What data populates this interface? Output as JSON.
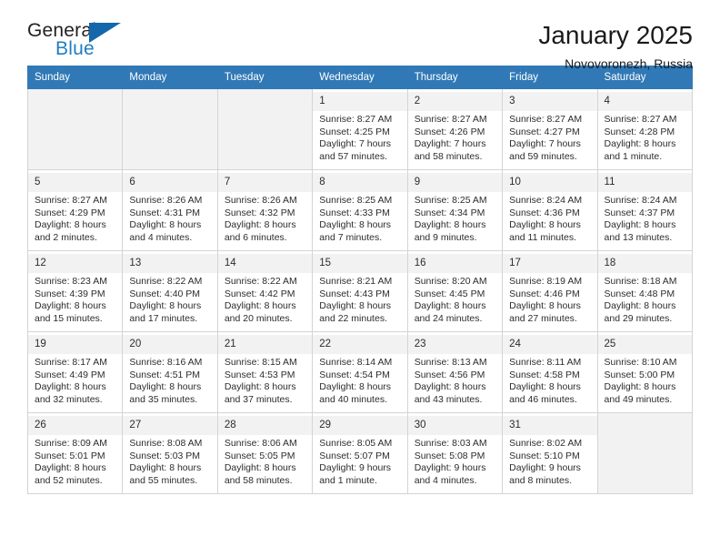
{
  "brand": {
    "name_line1": "General",
    "name_line2": "Blue",
    "triangle_color": "#1567ab",
    "blue_color": "#1f7ec2"
  },
  "header": {
    "title": "January 2025",
    "subtitle": "Novovoronezh, Russia"
  },
  "theme": {
    "header_bg": "#3179b6",
    "header_text": "#ffffff",
    "daynum_band": "#f2f2f2",
    "grid_border": "#d4d4d4"
  },
  "weekday_headers": [
    "Sunday",
    "Monday",
    "Tuesday",
    "Wednesday",
    "Thursday",
    "Friday",
    "Saturday"
  ],
  "labels": {
    "sunrise_prefix": "Sunrise: ",
    "sunset_prefix": "Sunset: ",
    "daylight_prefix": "Daylight: "
  },
  "weeks": [
    [
      {
        "empty": true
      },
      {
        "empty": true
      },
      {
        "empty": true
      },
      {
        "day": "1",
        "sunrise": "Sunrise: 8:27 AM",
        "sunset": "Sunset: 4:25 PM",
        "daylight1": "Daylight: 7 hours",
        "daylight2": "and 57 minutes."
      },
      {
        "day": "2",
        "sunrise": "Sunrise: 8:27 AM",
        "sunset": "Sunset: 4:26 PM",
        "daylight1": "Daylight: 7 hours",
        "daylight2": "and 58 minutes."
      },
      {
        "day": "3",
        "sunrise": "Sunrise: 8:27 AM",
        "sunset": "Sunset: 4:27 PM",
        "daylight1": "Daylight: 7 hours",
        "daylight2": "and 59 minutes."
      },
      {
        "day": "4",
        "sunrise": "Sunrise: 8:27 AM",
        "sunset": "Sunset: 4:28 PM",
        "daylight1": "Daylight: 8 hours",
        "daylight2": "and 1 minute."
      }
    ],
    [
      {
        "day": "5",
        "sunrise": "Sunrise: 8:27 AM",
        "sunset": "Sunset: 4:29 PM",
        "daylight1": "Daylight: 8 hours",
        "daylight2": "and 2 minutes."
      },
      {
        "day": "6",
        "sunrise": "Sunrise: 8:26 AM",
        "sunset": "Sunset: 4:31 PM",
        "daylight1": "Daylight: 8 hours",
        "daylight2": "and 4 minutes."
      },
      {
        "day": "7",
        "sunrise": "Sunrise: 8:26 AM",
        "sunset": "Sunset: 4:32 PM",
        "daylight1": "Daylight: 8 hours",
        "daylight2": "and 6 minutes."
      },
      {
        "day": "8",
        "sunrise": "Sunrise: 8:25 AM",
        "sunset": "Sunset: 4:33 PM",
        "daylight1": "Daylight: 8 hours",
        "daylight2": "and 7 minutes."
      },
      {
        "day": "9",
        "sunrise": "Sunrise: 8:25 AM",
        "sunset": "Sunset: 4:34 PM",
        "daylight1": "Daylight: 8 hours",
        "daylight2": "and 9 minutes."
      },
      {
        "day": "10",
        "sunrise": "Sunrise: 8:24 AM",
        "sunset": "Sunset: 4:36 PM",
        "daylight1": "Daylight: 8 hours",
        "daylight2": "and 11 minutes."
      },
      {
        "day": "11",
        "sunrise": "Sunrise: 8:24 AM",
        "sunset": "Sunset: 4:37 PM",
        "daylight1": "Daylight: 8 hours",
        "daylight2": "and 13 minutes."
      }
    ],
    [
      {
        "day": "12",
        "sunrise": "Sunrise: 8:23 AM",
        "sunset": "Sunset: 4:39 PM",
        "daylight1": "Daylight: 8 hours",
        "daylight2": "and 15 minutes."
      },
      {
        "day": "13",
        "sunrise": "Sunrise: 8:22 AM",
        "sunset": "Sunset: 4:40 PM",
        "daylight1": "Daylight: 8 hours",
        "daylight2": "and 17 minutes."
      },
      {
        "day": "14",
        "sunrise": "Sunrise: 8:22 AM",
        "sunset": "Sunset: 4:42 PM",
        "daylight1": "Daylight: 8 hours",
        "daylight2": "and 20 minutes."
      },
      {
        "day": "15",
        "sunrise": "Sunrise: 8:21 AM",
        "sunset": "Sunset: 4:43 PM",
        "daylight1": "Daylight: 8 hours",
        "daylight2": "and 22 minutes."
      },
      {
        "day": "16",
        "sunrise": "Sunrise: 8:20 AM",
        "sunset": "Sunset: 4:45 PM",
        "daylight1": "Daylight: 8 hours",
        "daylight2": "and 24 minutes."
      },
      {
        "day": "17",
        "sunrise": "Sunrise: 8:19 AM",
        "sunset": "Sunset: 4:46 PM",
        "daylight1": "Daylight: 8 hours",
        "daylight2": "and 27 minutes."
      },
      {
        "day": "18",
        "sunrise": "Sunrise: 8:18 AM",
        "sunset": "Sunset: 4:48 PM",
        "daylight1": "Daylight: 8 hours",
        "daylight2": "and 29 minutes."
      }
    ],
    [
      {
        "day": "19",
        "sunrise": "Sunrise: 8:17 AM",
        "sunset": "Sunset: 4:49 PM",
        "daylight1": "Daylight: 8 hours",
        "daylight2": "and 32 minutes."
      },
      {
        "day": "20",
        "sunrise": "Sunrise: 8:16 AM",
        "sunset": "Sunset: 4:51 PM",
        "daylight1": "Daylight: 8 hours",
        "daylight2": "and 35 minutes."
      },
      {
        "day": "21",
        "sunrise": "Sunrise: 8:15 AM",
        "sunset": "Sunset: 4:53 PM",
        "daylight1": "Daylight: 8 hours",
        "daylight2": "and 37 minutes."
      },
      {
        "day": "22",
        "sunrise": "Sunrise: 8:14 AM",
        "sunset": "Sunset: 4:54 PM",
        "daylight1": "Daylight: 8 hours",
        "daylight2": "and 40 minutes."
      },
      {
        "day": "23",
        "sunrise": "Sunrise: 8:13 AM",
        "sunset": "Sunset: 4:56 PM",
        "daylight1": "Daylight: 8 hours",
        "daylight2": "and 43 minutes."
      },
      {
        "day": "24",
        "sunrise": "Sunrise: 8:11 AM",
        "sunset": "Sunset: 4:58 PM",
        "daylight1": "Daylight: 8 hours",
        "daylight2": "and 46 minutes."
      },
      {
        "day": "25",
        "sunrise": "Sunrise: 8:10 AM",
        "sunset": "Sunset: 5:00 PM",
        "daylight1": "Daylight: 8 hours",
        "daylight2": "and 49 minutes."
      }
    ],
    [
      {
        "day": "26",
        "sunrise": "Sunrise: 8:09 AM",
        "sunset": "Sunset: 5:01 PM",
        "daylight1": "Daylight: 8 hours",
        "daylight2": "and 52 minutes."
      },
      {
        "day": "27",
        "sunrise": "Sunrise: 8:08 AM",
        "sunset": "Sunset: 5:03 PM",
        "daylight1": "Daylight: 8 hours",
        "daylight2": "and 55 minutes."
      },
      {
        "day": "28",
        "sunrise": "Sunrise: 8:06 AM",
        "sunset": "Sunset: 5:05 PM",
        "daylight1": "Daylight: 8 hours",
        "daylight2": "and 58 minutes."
      },
      {
        "day": "29",
        "sunrise": "Sunrise: 8:05 AM",
        "sunset": "Sunset: 5:07 PM",
        "daylight1": "Daylight: 9 hours",
        "daylight2": "and 1 minute."
      },
      {
        "day": "30",
        "sunrise": "Sunrise: 8:03 AM",
        "sunset": "Sunset: 5:08 PM",
        "daylight1": "Daylight: 9 hours",
        "daylight2": "and 4 minutes."
      },
      {
        "day": "31",
        "sunrise": "Sunrise: 8:02 AM",
        "sunset": "Sunset: 5:10 PM",
        "daylight1": "Daylight: 9 hours",
        "daylight2": "and 8 minutes."
      },
      {
        "empty": true
      }
    ]
  ]
}
